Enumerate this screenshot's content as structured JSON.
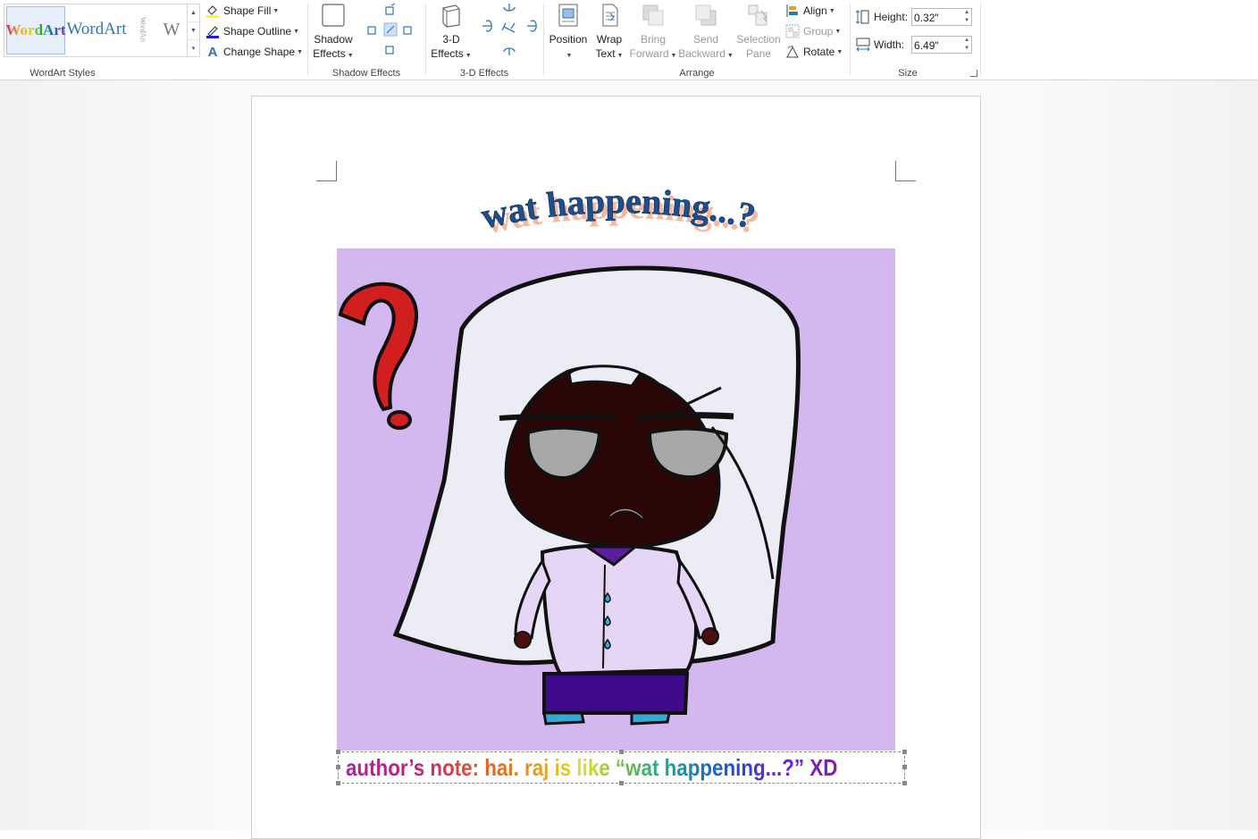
{
  "ribbon": {
    "wordart_styles": {
      "label": "WordArt Styles",
      "samples": [
        "WordArt",
        "WordArt",
        "WordArt",
        "W"
      ]
    },
    "shape_commands": {
      "fill": "Shape Fill",
      "outline": "Shape Outline",
      "change": "Change Shape"
    },
    "shadow": {
      "button_line1": "Shadow",
      "button_line2": "Effects",
      "label": "Shadow Effects"
    },
    "three_d": {
      "button_line1": "3-D",
      "button_line2": "Effects",
      "label": "3-D Effects"
    },
    "arrange": {
      "label": "Arrange",
      "position": "Position",
      "wrap_line1": "Wrap",
      "wrap_line2": "Text",
      "bring_line1": "Bring",
      "bring_line2": "Forward",
      "send_line1": "Send",
      "send_line2": "Backward",
      "selection_line1": "Selection",
      "selection_line2": "Pane",
      "align": "Align",
      "group": "Group",
      "rotate": "Rotate"
    },
    "size": {
      "label": "Size",
      "height_label": "Height:",
      "height_value": "0.32\"",
      "width_label": "Width:",
      "width_value": "6.49\""
    }
  },
  "document": {
    "title_wordart": "wat happening...?",
    "author_note": "author’s note: hai. raj is like “wat happening...?” XD"
  },
  "colors": {
    "picture_background": "#d3b8ef",
    "question_mark": "#d11f1f",
    "accent_blue": "#2e75b6"
  }
}
